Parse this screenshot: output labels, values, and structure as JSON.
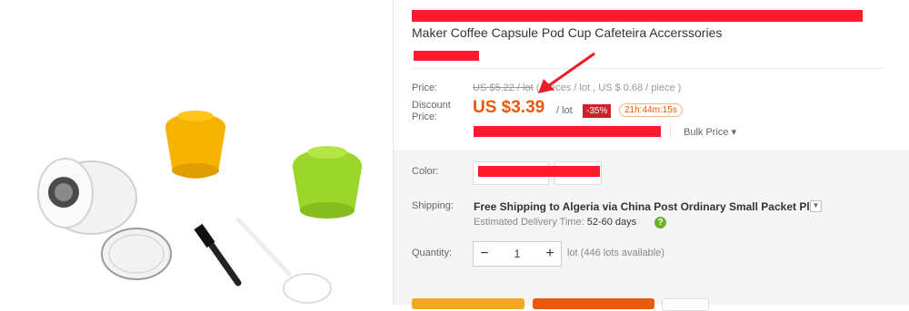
{
  "product": {
    "title": "Maker Coffee Capsule Pod Cup Cafeteira Accerssories"
  },
  "price": {
    "label": "Price:",
    "original": "US $5.22 / lot",
    "original_detail": "( pieces / lot , US $ 0.68 / piece )",
    "discount_label_line1": "Discount",
    "discount_label_line2": "Price:",
    "discount": "US $3.39",
    "unit": "/ lot",
    "off_badge": "-35%",
    "timer": "21h:44m:15s",
    "bulk_price": "Bulk Price"
  },
  "color": {
    "label": "Color:"
  },
  "shipping": {
    "label": "Shipping:",
    "free": "Free Shipping",
    "to": " to Algeria via China Post Ordinary Small Packet Plus",
    "est_label": "Estimated Delivery Time:",
    "est_value": "52-60 days"
  },
  "quantity": {
    "label": "Quantity:",
    "minus": "−",
    "value": "1",
    "plus": "+",
    "available": "lot (446 lots available)"
  },
  "colors": {
    "accent": "#e8590c",
    "badge": "#c9242b",
    "redaction": "#ff1a2e",
    "yellow_capsule": "#f6b400",
    "green_capsule": "#9dd62a"
  }
}
